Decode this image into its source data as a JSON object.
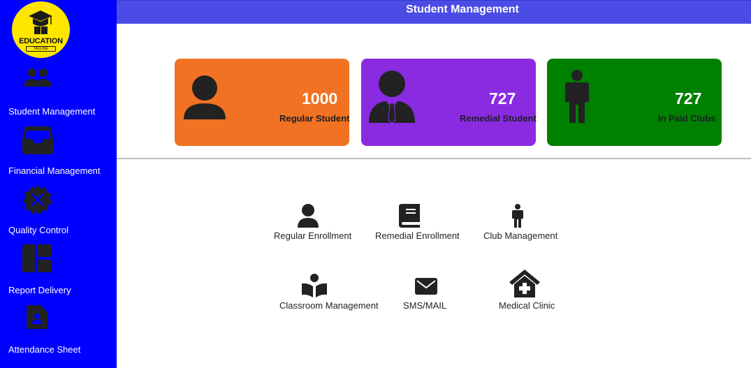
{
  "brand": {
    "title": "EDUCATION",
    "tagline": "TAGLINE"
  },
  "sidebar": {
    "items": [
      {
        "label": "Student Management",
        "icon": "users-icon"
      },
      {
        "label": "Financial Management",
        "icon": "inbox-icon"
      },
      {
        "label": "Quality Control",
        "icon": "badge-tools-icon"
      },
      {
        "label": "Report Delivery",
        "icon": "dashboard-icon"
      },
      {
        "label": "Attendance Sheet",
        "icon": "contact-file-icon"
      }
    ]
  },
  "header": {
    "title": "Student Management"
  },
  "stats": [
    {
      "value": "1000",
      "label": "Regular Student",
      "color": "#f07222",
      "icon": "user-icon"
    },
    {
      "value": "727",
      "label": "Remedial Student",
      "color": "#8a2be2",
      "icon": "user-tie-icon"
    },
    {
      "value": "727",
      "label": "In Paid Clubs",
      "color": "#008000",
      "icon": "male-icon"
    }
  ],
  "actions": [
    {
      "label": "Regular Enrollment",
      "icon": "user-icon"
    },
    {
      "label": "Remedial Enrollment",
      "icon": "book-icon"
    },
    {
      "label": "Club Management",
      "icon": "male-icon"
    },
    {
      "label": "Classroom Management",
      "icon": "book-reader-icon"
    },
    {
      "label": "SMS/MAIL",
      "icon": "envelope-icon"
    },
    {
      "label": "Medical Clinic",
      "icon": "clinic-icon"
    }
  ]
}
